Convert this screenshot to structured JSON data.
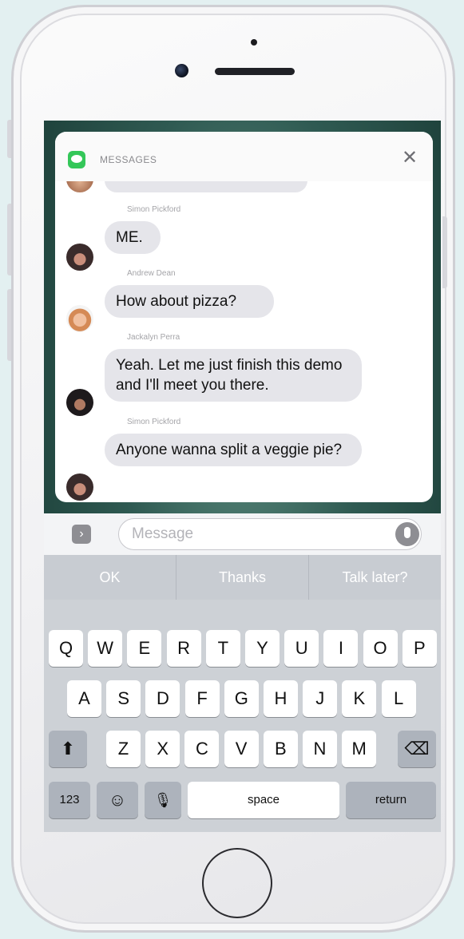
{
  "notification": {
    "app_name": "MESSAGES",
    "close_glyph": "✕",
    "messages": [
      {
        "sender": "Simon Pickford",
        "text": "ME.",
        "avatar": "simon"
      },
      {
        "sender": "Andrew Dean",
        "text": "How about pizza?",
        "avatar": "andrew"
      },
      {
        "sender": "Jackalyn Perra",
        "text": "Yeah. Let me just finish this demo and I'll meet you there.",
        "avatar": "jacky"
      },
      {
        "sender": "Simon Pickford",
        "text": "Anyone wanna split a veggie pie?",
        "avatar": "simon"
      }
    ]
  },
  "input_bar": {
    "expand_glyph": "›",
    "placeholder": "Message"
  },
  "keyboard": {
    "suggestions": [
      "OK",
      "Thanks",
      "Talk later?"
    ],
    "row1": [
      "Q",
      "W",
      "E",
      "R",
      "T",
      "Y",
      "U",
      "I",
      "O",
      "P"
    ],
    "row2": [
      "A",
      "S",
      "D",
      "F",
      "G",
      "H",
      "J",
      "K",
      "L"
    ],
    "row3": [
      "Z",
      "X",
      "C",
      "V",
      "B",
      "N",
      "M"
    ],
    "shift_glyph": "⬆",
    "delete_glyph": "⌫",
    "numbers_label": "123",
    "emoji_glyph": "☺",
    "dictation_glyph": "🎙",
    "space_label": "space",
    "return_label": "return"
  },
  "colors": {
    "bubble": "#e5e5ea",
    "app_icon": "#34c759",
    "keyboard_bg": "#cdd1d6"
  }
}
